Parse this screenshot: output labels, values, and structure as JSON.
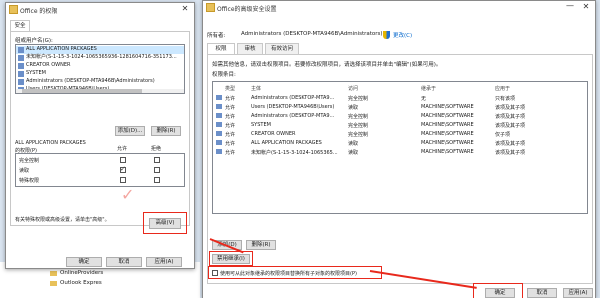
{
  "left_window": {
    "title": "Office 的权限",
    "tab_security": "安全",
    "groups_label": "组或用户名(G):",
    "users": [
      "ALL APPLICATION PACKAGES",
      "未知帐户(S-1-15-3-1024-1065365936-1281604716-351173...",
      "CREATOR OWNER",
      "SYSTEM",
      "Administrators (DESKTOP-MTA946B\\Administrators)",
      "Users (DESKTOP-MTA946B\\Users)"
    ],
    "add_button": "添加(D)...",
    "remove_button": "删除(R)",
    "permission_for_line1": "ALL APPLICATION PACKAGES",
    "permission_for_line2": "的权限(P)",
    "allow_header": "允许",
    "deny_header": "拒绝",
    "permissions": [
      "完全控制",
      "读取",
      "特殊权限"
    ],
    "special_note": "有关特殊权限或高级设置，请单击\"高级\"。",
    "advanced_button": "高级(V)",
    "ok_button": "确定",
    "cancel_button": "取消",
    "apply_button": "应用(A)"
  },
  "tree_items": [
    "OnlineProviders",
    "Outlook Expres"
  ],
  "right_window": {
    "title": "Office的高级安全设置",
    "owner_label": "所有者:",
    "owner_value": "Administrators (DESKTOP-MTA946B\\Administrators)",
    "change_link": "更改(C)",
    "tabs": [
      "权限",
      "审核",
      "有效访问"
    ],
    "info_text": "如需其他信息，请双击权限项目。若要修改权限项目，请选择该项目并单击\"编辑\"(如果可用)。",
    "entries_label": "权限条目:",
    "columns": [
      "类型",
      "主体",
      "访问",
      "继承于",
      "应用于"
    ],
    "entries": [
      {
        "type": "允许",
        "principal": "Administrators (DESKTOP-MTA9...",
        "access": "完全控制",
        "inherited": "无",
        "applies": "只有该项"
      },
      {
        "type": "允许",
        "principal": "Users (DESKTOP-MTA946B\\Users)",
        "access": "读取",
        "inherited": "MACHINE\\SOFTWARE",
        "applies": "该项及其子项"
      },
      {
        "type": "允许",
        "principal": "Administrators (DESKTOP-MTA9...",
        "access": "完全控制",
        "inherited": "MACHINE\\SOFTWARE",
        "applies": "该项及其子项"
      },
      {
        "type": "允许",
        "principal": "SYSTEM",
        "access": "完全控制",
        "inherited": "MACHINE\\SOFTWARE",
        "applies": "该项及其子项"
      },
      {
        "type": "允许",
        "principal": "CREATOR OWNER",
        "access": "完全控制",
        "inherited": "MACHINE\\SOFTWARE",
        "applies": "仅子项"
      },
      {
        "type": "允许",
        "principal": "ALL APPLICATION PACKAGES",
        "access": "读取",
        "inherited": "MACHINE\\SOFTWARE",
        "applies": "该项及其子项"
      },
      {
        "type": "允许",
        "principal": "未知帐户(S-1-15-3-1024-1065365...",
        "access": "读取",
        "inherited": "MACHINE\\SOFTWARE",
        "applies": "该项及其子项"
      }
    ],
    "add_button": "添加(D)",
    "remove_button": "删除(R)",
    "disable_inheritance_button": "禁用继承(I)",
    "replace_checkbox_label": "使用可从此对象继承的权限项目替换所有子对象的权限项目(P)",
    "ok_button": "确定",
    "cancel_button": "取消",
    "apply_button": "应用(A)"
  },
  "colors": {
    "highlight": "#e8291c",
    "faded_check": "#f4a6a0"
  }
}
